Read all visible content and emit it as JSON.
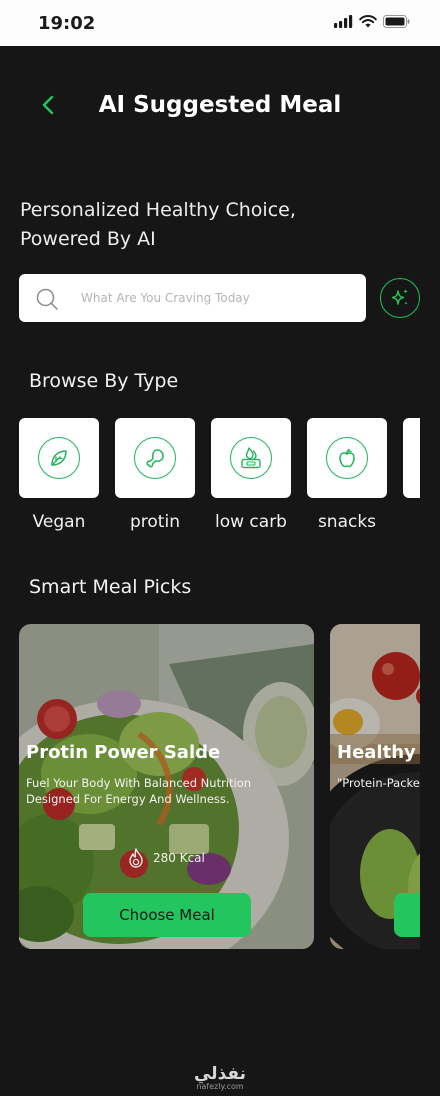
{
  "status_bar": {
    "time": "19:02"
  },
  "header": {
    "title": "AI Suggested Meal"
  },
  "tagline": {
    "line1": "Personalized Healthy Choice,",
    "line2": "Powered By AI"
  },
  "search": {
    "placeholder": "What Are You Craving Today"
  },
  "browse": {
    "title": "Browse By Type",
    "items": [
      {
        "label": "Vegan",
        "icon": "leaf-icon"
      },
      {
        "label": "protin",
        "icon": "drumstick-icon"
      },
      {
        "label": "low carb",
        "icon": "food-scale-icon"
      },
      {
        "label": "snacks",
        "icon": "apple-icon"
      }
    ]
  },
  "picks": {
    "title": "Smart Meal Picks",
    "meals": [
      {
        "name": "Protin Power Salde",
        "description": "Fuel Your Body With Balanced Nutrition Designed For Energy And Wellness.",
        "kcal": "280 Kcal",
        "button": "Choose Meal"
      },
      {
        "name": "Healthy E",
        "description": "\"Protein-Packe"
      }
    ]
  },
  "watermark": {
    "arabic": "نفذلي",
    "latin": "nafezly.com"
  },
  "colors": {
    "accent": "#22c55e",
    "background": "#161616",
    "card": "#ffffff"
  }
}
